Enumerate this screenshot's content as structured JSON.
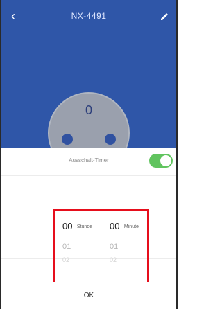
{
  "header": {
    "title": "NX-4491",
    "back_icon": "chevron-left-icon",
    "edit_icon": "pencil-icon"
  },
  "device": {
    "display_value": "0"
  },
  "timer": {
    "label": "Ausschalt-Timer",
    "enabled": true
  },
  "picker": {
    "hours": {
      "selected": "00",
      "unit": "Stunde",
      "next": "01",
      "after": "02"
    },
    "minutes": {
      "selected": "00",
      "unit": "Minute",
      "next": "01",
      "after": "02"
    }
  },
  "actions": {
    "ok_label": "OK"
  },
  "colors": {
    "header_blue": "#2f56a8",
    "toggle_green": "#61c45f",
    "highlight_red": "#e60e1c"
  }
}
